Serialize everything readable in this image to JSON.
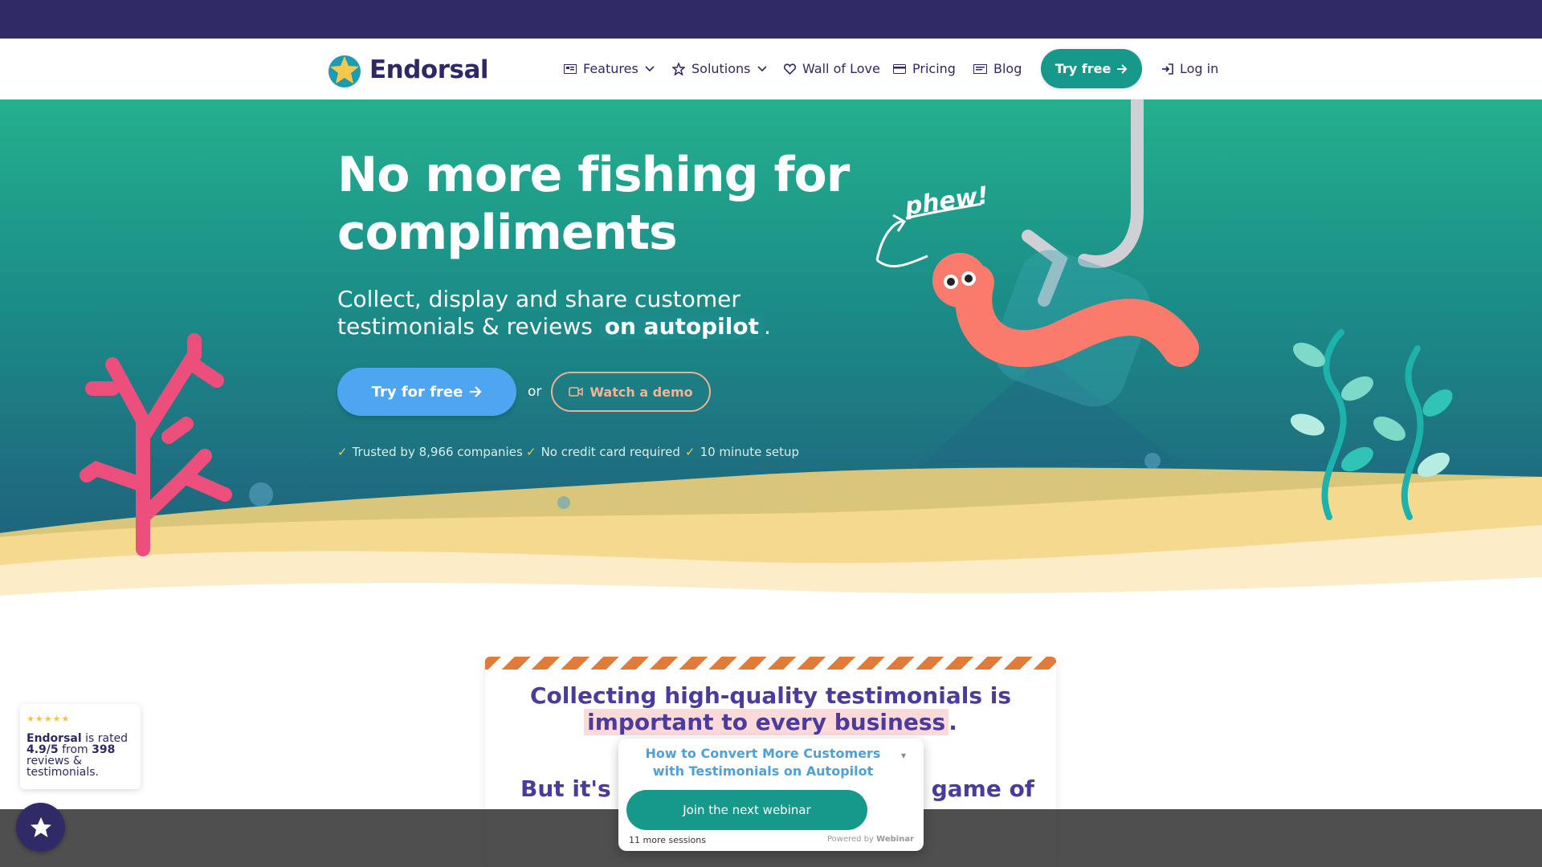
{
  "brand": {
    "name": "Endorsal"
  },
  "nav": {
    "items": [
      {
        "label": "Features",
        "icon": "features-icon",
        "dropdown": true
      },
      {
        "label": "Solutions",
        "icon": "star-icon",
        "dropdown": true
      },
      {
        "label": "Wall of Love",
        "icon": "heart-icon",
        "dropdown": false
      },
      {
        "label": "Pricing",
        "icon": "credit-card-icon",
        "dropdown": false
      },
      {
        "label": "Blog",
        "icon": "blog-icon",
        "dropdown": false
      }
    ],
    "try_free": "Try free",
    "login": "Log in"
  },
  "hero": {
    "title": "No more fishing for compliments",
    "subtitle_prefix": "Collect, display and share customer testimonials & reviews",
    "subtitle_highlight": "on autopilot",
    "subtitle_suffix": ".",
    "cta": "Try for free",
    "or": "or",
    "demo": "Watch a demo",
    "illustration_text": "phew!",
    "trust": [
      "Trusted by 8,966 companies",
      "No credit card required",
      "10 minute setup"
    ]
  },
  "card": {
    "heading_prefix": "Collecting high-quality testimonials is",
    "heading_highlight": "important to every business",
    "heading_suffix": ".",
    "subheading_start": "But it's a",
    "subheading_end": "game of"
  },
  "rating_widget": {
    "brand": "Endorsal",
    "text_1": "is rated",
    "score": "4.9/5",
    "text_2": "from",
    "count": "398",
    "text_3": "reviews & testimonials."
  },
  "webinar": {
    "title": "How to Convert More Customers with Testimonials on Autopilot",
    "button": "Join the next webinar",
    "sessions": "11 more sessions",
    "powered": "Powered by",
    "powered_brand": "Webinar"
  },
  "colors": {
    "navy": "#302a67",
    "teal": "#16998a",
    "blue": "#4ea6f0",
    "coral": "#f4b394",
    "purple": "#4a3b9c"
  }
}
